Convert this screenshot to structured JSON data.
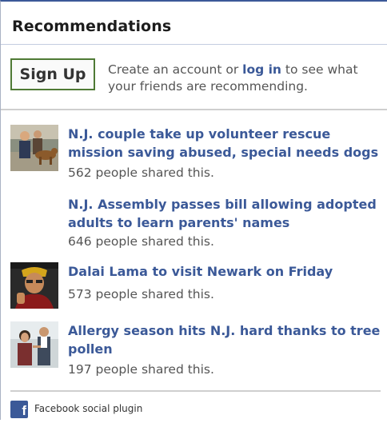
{
  "header": {
    "title": "Recommendations"
  },
  "signup": {
    "button_label": "Sign Up",
    "text_before": "Create an account or ",
    "login_link": "log in",
    "text_after": " to see what your friends are recommending."
  },
  "items": [
    {
      "title": "N.J. couple take up volunteer rescue mission saving abused, special needs dogs",
      "meta": "562 people shared this.",
      "thumbnail": "dogs-photo"
    },
    {
      "title": "N.J. Assembly passes bill allowing adopted adults to learn parents' names",
      "meta": "646 people shared this.",
      "thumbnail": ""
    },
    {
      "title": "Dalai Lama to visit Newark on Friday",
      "meta": "573 people shared this.",
      "thumbnail": "dalai-lama-photo"
    },
    {
      "title": "Allergy season hits N.J. hard thanks to tree pollen",
      "meta": "197 people shared this.",
      "thumbnail": "doctor-patient-photo"
    }
  ],
  "footer": {
    "label": "Facebook social plugin"
  },
  "colors": {
    "link": "#3b5998",
    "text": "#333333",
    "muted": "#555555",
    "button_border": "#4f7a35"
  }
}
